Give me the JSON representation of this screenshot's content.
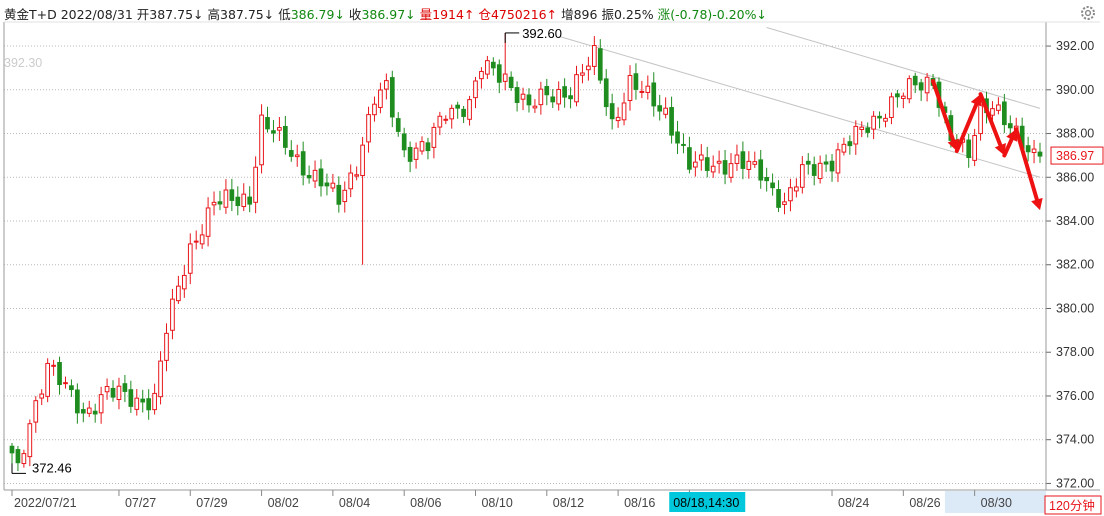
{
  "header": {
    "name": "黄金T+D",
    "date": "2022/08/31",
    "open_label": "开",
    "open_value": "387.75↓",
    "high_label": "高",
    "high_value": "387.75↓",
    "low_label": "低",
    "low_value": "386.79↓",
    "close_label": "收",
    "close_value": "386.97↓",
    "volume_label": "量",
    "volume_value": "1914↑",
    "oi_label": "仓",
    "oi_value": "4750216↑",
    "inc_label": "增",
    "inc_value": "896",
    "amp_label": "振",
    "amp_value": "0.25%",
    "chg_label": "涨",
    "chg_value": "(-0.78)-0.20%↓"
  },
  "overlay": {
    "ghost_price": "392.30",
    "current_price": "386.97",
    "high_marker": "392.60",
    "low_marker": "372.46",
    "cursor_time": "08/18,14:30",
    "period": "120分钟"
  },
  "colors": {
    "up": "#e8161b",
    "down": "#1e8c1e",
    "header_up": "#dd0000",
    "header_down": "#118811",
    "grid": "#b9b9b9",
    "arrow": "#ee1111",
    "channel": "#c4c4c4",
    "cursor_bg": "#00c8dc",
    "range_highlight": "#dce9f7"
  },
  "chart_data": {
    "type": "candlestick",
    "title": "",
    "xlabel": "",
    "ylabel": "",
    "ylim": [
      371.7,
      393.1
    ],
    "y_ticks": [
      372,
      374,
      376,
      378,
      380,
      382,
      384,
      386,
      388,
      390,
      392
    ],
    "y_tick_labels": [
      "372.00",
      "374.00",
      "376.00",
      "378.00",
      "380.00",
      "382.00",
      "384.00",
      "386.00",
      "388.00",
      "390.00",
      "392.00"
    ],
    "x_tick_labels": [
      "2022/07/21",
      "07/27",
      "07/29",
      "08/02",
      "08/04",
      "08/06",
      "08/10",
      "08/12",
      "08/16",
      "08/18",
      "08/24",
      "08/26",
      "08/30"
    ],
    "x_tick_positions": [
      0,
      18,
      30,
      42,
      54,
      66,
      78,
      90,
      102,
      114,
      138,
      150,
      162
    ],
    "n_bars": 174,
    "anchors": [
      [
        0,
        373.2
      ],
      [
        1,
        372.5
      ],
      [
        3,
        374.8
      ],
      [
        6,
        377.5
      ],
      [
        9,
        376.3
      ],
      [
        12,
        375.2
      ],
      [
        16,
        376.2
      ],
      [
        21,
        375.8
      ],
      [
        24,
        375.9
      ],
      [
        26,
        379.0
      ],
      [
        30,
        382.8
      ],
      [
        34,
        384.8
      ],
      [
        38,
        385.0
      ],
      [
        40,
        385.1
      ],
      [
        42,
        388.5
      ],
      [
        46,
        387.5
      ],
      [
        50,
        386.2
      ],
      [
        55,
        385.0
      ],
      [
        58,
        386.6
      ],
      [
        61,
        389.5
      ],
      [
        63,
        390.0
      ],
      [
        66,
        387.2
      ],
      [
        70,
        387.4
      ],
      [
        73,
        389.0
      ],
      [
        77,
        389.4
      ],
      [
        79,
        391.0
      ],
      [
        83,
        390.6
      ],
      [
        87,
        389.2
      ],
      [
        90,
        389.7
      ],
      [
        94,
        390.0
      ],
      [
        98,
        391.5
      ],
      [
        101,
        388.5
      ],
      [
        104,
        390.3
      ],
      [
        110,
        389.0
      ],
      [
        114,
        386.5
      ],
      [
        118,
        386.6
      ],
      [
        122,
        386.7
      ],
      [
        126,
        386.2
      ],
      [
        130,
        384.8
      ],
      [
        133,
        386.2
      ],
      [
        138,
        386.8
      ],
      [
        144,
        388.4
      ],
      [
        148,
        389.4
      ],
      [
        152,
        390.2
      ],
      [
        155,
        390.5
      ],
      [
        158,
        387.7
      ],
      [
        161,
        387.0
      ],
      [
        163,
        389.3
      ],
      [
        165,
        389.4
      ],
      [
        167,
        388.5
      ],
      [
        170,
        387.5
      ],
      [
        173,
        386.97
      ]
    ],
    "series": [],
    "annotations": {
      "period_high": {
        "value": 392.6,
        "bar": 83
      },
      "period_low": {
        "value": 372.46,
        "bar": 0
      },
      "long_lower_wick": {
        "value": 382.0,
        "bar": 59
      }
    },
    "channel_lines": [
      [
        [
          127,
          392.85
        ],
        [
          173,
          389.15
        ]
      ],
      [
        [
          92,
          392.45
        ],
        [
          173,
          386.0
        ]
      ]
    ],
    "projection_arrows": [
      [
        155,
        390.4
      ],
      [
        159,
        387.2
      ],
      [
        163,
        389.8
      ],
      [
        167,
        387.0
      ],
      [
        169,
        388.2
      ],
      [
        173,
        384.5
      ]
    ],
    "grid": true,
    "legend": "none"
  }
}
